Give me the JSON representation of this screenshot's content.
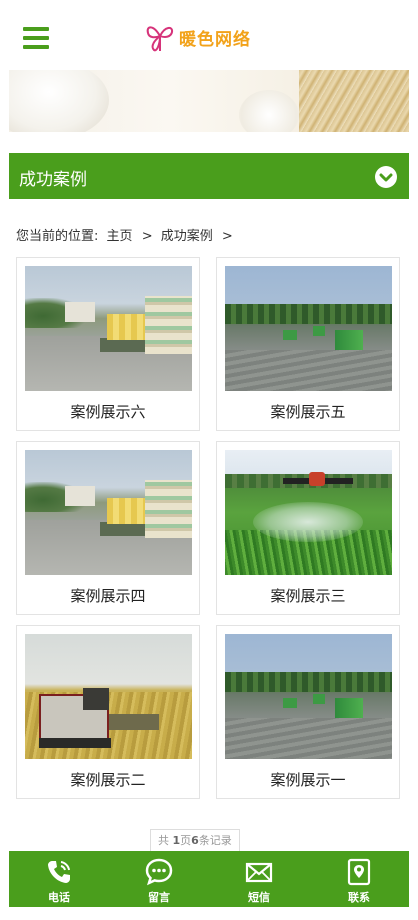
{
  "logo": {
    "text": "暖色网络"
  },
  "section": {
    "title": "成功案例"
  },
  "breadcrumb": {
    "prefix": "您当前的位置:",
    "home": "主页",
    "separator": ">",
    "current": "成功案例",
    "trail_separator": ">"
  },
  "cases": [
    {
      "title": "案例展示六",
      "photo": "truck"
    },
    {
      "title": "案例展示五",
      "photo": "paddy"
    },
    {
      "title": "案例展示四",
      "photo": "truck"
    },
    {
      "title": "案例展示三",
      "photo": "drone"
    },
    {
      "title": "案例展示二",
      "photo": "harvest"
    },
    {
      "title": "案例展示一",
      "photo": "paddy"
    }
  ],
  "pagination": {
    "prefix": "共",
    "pages": "1",
    "page_unit": "页",
    "records": "6",
    "record_unit": "条记录"
  },
  "bottom_nav": [
    {
      "label": "电话",
      "icon": "phone-icon"
    },
    {
      "label": "留言",
      "icon": "message-icon"
    },
    {
      "label": "短信",
      "icon": "mail-icon"
    },
    {
      "label": "联系",
      "icon": "location-icon"
    }
  ],
  "colors": {
    "accent": "#4a9e1c",
    "logo_text": "#f2a21a",
    "logo_mark": "#d6337a"
  }
}
